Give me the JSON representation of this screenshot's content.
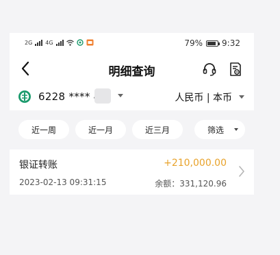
{
  "status_bar": {
    "net1": "2G",
    "net2": "4G",
    "battery": "79%",
    "time": "9:32"
  },
  "nav": {
    "title": "明细查询"
  },
  "account": {
    "number": "6228 **** 4",
    "currency": "人民币 | 本币"
  },
  "filters": {
    "week": "近一周",
    "month": "近一月",
    "three_months": "近三月",
    "filter": "筛选"
  },
  "transactions": [
    {
      "title": "银证转账",
      "amount": "+210,000.00",
      "time": "2023-02-13 09:31:15",
      "balance": "余额：331,120.96"
    }
  ],
  "colors": {
    "amount_positive": "#e8a22a",
    "bank_logo": "#1a9a6c"
  }
}
